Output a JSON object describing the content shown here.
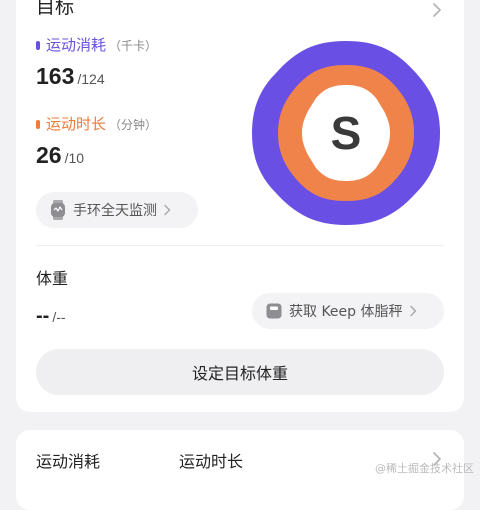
{
  "goal_card": {
    "title": "目标",
    "calories": {
      "label": "运动消耗",
      "unit": "（千卡）",
      "value": "163",
      "target": "/124",
      "color": "#6a50e0"
    },
    "duration": {
      "label": "运动时长",
      "unit": "（分钟）",
      "value": "26",
      "target": "/10",
      "color": "#ef7a3b"
    },
    "badge": {
      "letter": "S",
      "outer_color": "#6a4fe4",
      "ring_color": "#f0834a",
      "inner_color": "#ffffff",
      "letter_color": "#3a3a3a"
    },
    "band_pill": {
      "label": "手环全天监测",
      "icon": "watch-icon"
    },
    "weight": {
      "label": "体重",
      "value": "--",
      "target": "/--"
    },
    "scale_pill": {
      "label": "获取 Keep 体脂秤",
      "icon": "scale-icon"
    },
    "set_weight_button": "设定目标体重"
  },
  "bottom_card": {
    "col1": "运动消耗",
    "col2": "运动时长"
  },
  "watermark": "@稀土掘金技术社区"
}
